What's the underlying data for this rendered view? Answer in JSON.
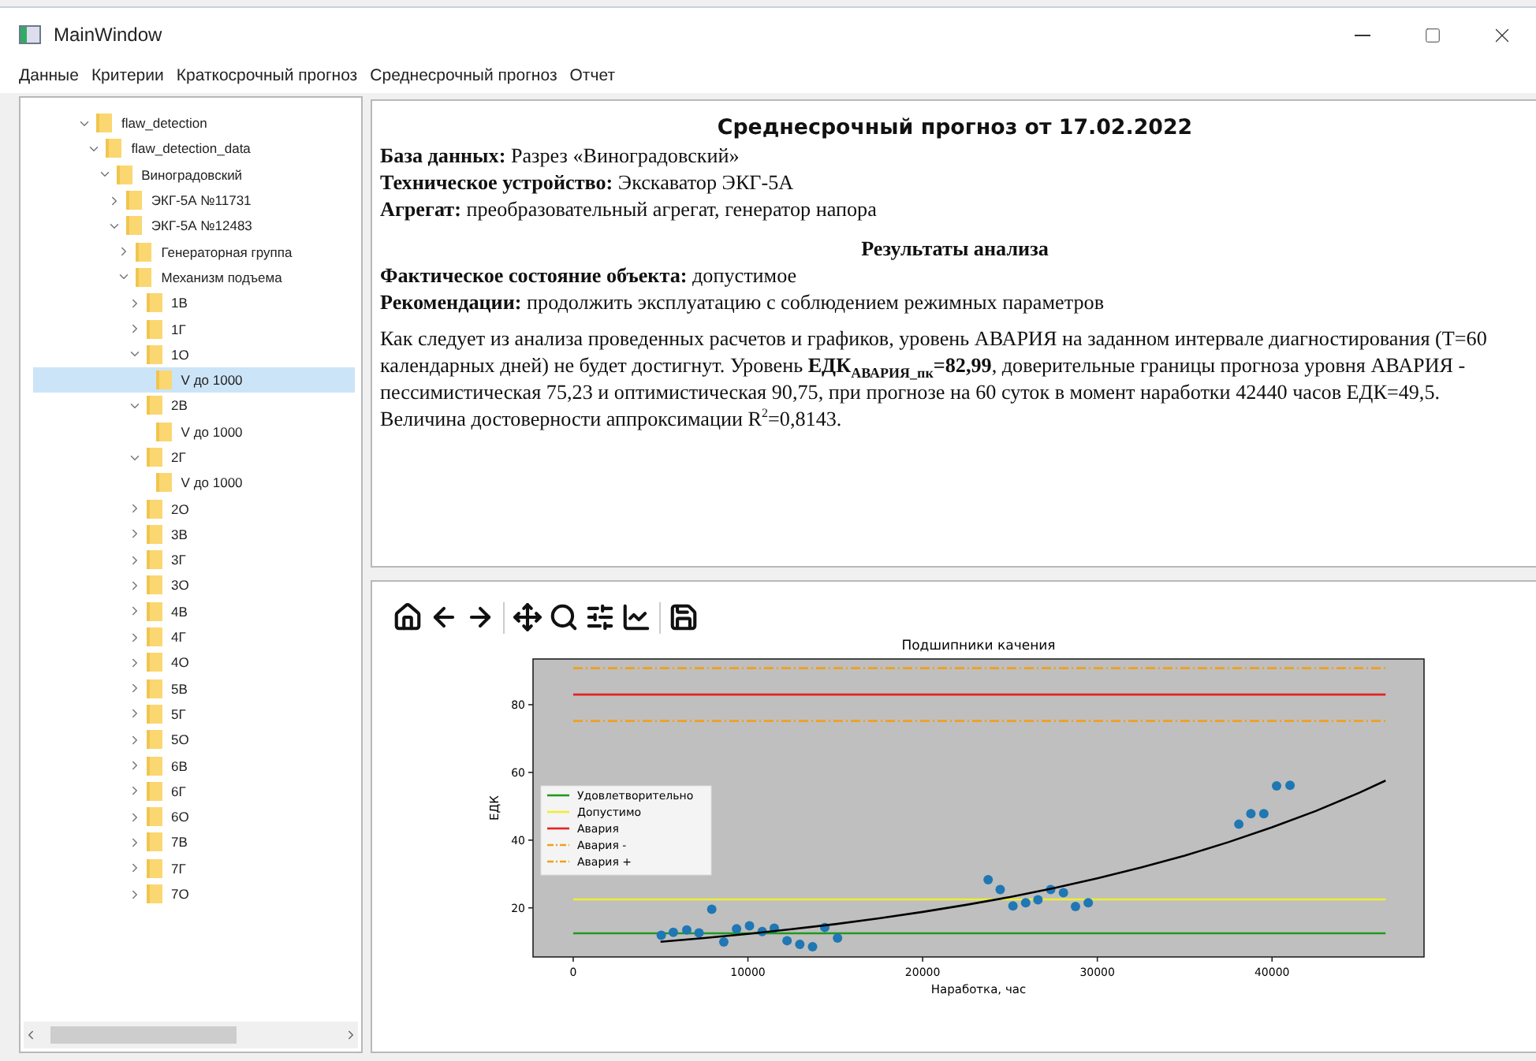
{
  "window": {
    "title": "MainWindow"
  },
  "menu": [
    "Данные",
    "Критерии",
    "Краткосрочный прогноз",
    "Среднесрочный прогноз",
    "Отчет"
  ],
  "tree": [
    {
      "label": "flaw_detection",
      "expanded": true,
      "selected": false,
      "children": [
        {
          "label": "flaw_detection_data",
          "expanded": true,
          "selected": false,
          "children": [
            {
              "label": "Виноградовский",
              "expanded": true,
              "selected": false,
              "children": [
                {
                  "label": "ЭКГ-5А №11731",
                  "expanded": false,
                  "selected": false
                },
                {
                  "label": "ЭКГ-5А №12483",
                  "expanded": true,
                  "selected": false,
                  "children": [
                    {
                      "label": "Генераторная группа",
                      "expanded": false,
                      "selected": false
                    },
                    {
                      "label": "Механизм подъема",
                      "expanded": true,
                      "selected": false,
                      "children": [
                        {
                          "label": "1В",
                          "expanded": false,
                          "selected": false
                        },
                        {
                          "label": "1Г",
                          "expanded": false,
                          "selected": false
                        },
                        {
                          "label": "1О",
                          "expanded": true,
                          "selected": false,
                          "children": [
                            {
                              "label": "V до 1000",
                              "selected": true
                            }
                          ]
                        },
                        {
                          "label": "2В",
                          "expanded": true,
                          "selected": false,
                          "children": [
                            {
                              "label": "V до 1000",
                              "selected": false
                            }
                          ]
                        },
                        {
                          "label": "2Г",
                          "expanded": true,
                          "selected": false,
                          "children": [
                            {
                              "label": "V до 1000",
                              "selected": false
                            }
                          ]
                        },
                        {
                          "label": "2О",
                          "expanded": false,
                          "selected": false
                        },
                        {
                          "label": "3В",
                          "expanded": false,
                          "selected": false
                        },
                        {
                          "label": "3Г",
                          "expanded": false,
                          "selected": false
                        },
                        {
                          "label": "3О",
                          "expanded": false,
                          "selected": false
                        },
                        {
                          "label": "4В",
                          "expanded": false,
                          "selected": false
                        },
                        {
                          "label": "4Г",
                          "expanded": false,
                          "selected": false
                        },
                        {
                          "label": "4О",
                          "expanded": false,
                          "selected": false
                        },
                        {
                          "label": "5В",
                          "expanded": false,
                          "selected": false
                        },
                        {
                          "label": "5Г",
                          "expanded": false,
                          "selected": false
                        },
                        {
                          "label": "5О",
                          "expanded": false,
                          "selected": false
                        },
                        {
                          "label": "6В",
                          "expanded": false,
                          "selected": false
                        },
                        {
                          "label": "6Г",
                          "expanded": false,
                          "selected": false
                        },
                        {
                          "label": "6О",
                          "expanded": false,
                          "selected": false
                        },
                        {
                          "label": "7В",
                          "expanded": false,
                          "selected": false
                        },
                        {
                          "label": "7Г",
                          "expanded": false,
                          "selected": false
                        },
                        {
                          "label": "7О",
                          "expanded": false,
                          "selected": false
                        }
                      ]
                    }
                  ]
                }
              ]
            }
          ]
        }
      ]
    }
  ],
  "report": {
    "title": "Среднесрочный прогноз от 17.02.2022",
    "details": [
      "**База данных:** Разрез «Виноградовский»",
      "**Техническое устройство:** Экскаватор ЭКГ-5А",
      "**Агрегат:** преобразовательный агрегат, генератор напора"
    ],
    "section_title": "Результаты анализа",
    "findings": [
      "**Фактическое состояние объекта:** допустимое",
      "**Рекомендации:** продолжить эксплуатацию с соблюдением режимных параметров"
    ],
    "paragraph": "Как следует из анализа проведенных расчетов и графиков, уровень АВАРИЯ на заданном интервале диагностирования (Т=60 календарных дней) не будет достигнут. Уровень **ЕДК**$_{АВАРИЯ_пк}$**=82,99**, доверительные границы прогноза уровня АВАРИЯ - пессимистическая 75,23 и оптимистическая 90,75, при прогнозе на 60 суток в момент наработки 42440 часов ЕДК=49,5. Величина достоверности аппроксимации R$^{2}$=0,8143."
  },
  "plot": {
    "chart_data": {
      "type": "scatter",
      "title": "Подшипники качения",
      "xlabel": "Наработка, час",
      "ylabel": "ЕДК",
      "xlim": [
        -2300,
        48700
      ],
      "ylim": [
        5.5,
        93.5
      ],
      "xticks": [
        0,
        10000,
        20000,
        30000,
        40000
      ],
      "yticks": [
        20,
        40,
        60,
        80
      ],
      "legend": "center left",
      "series": [
        {
          "name": "Удовлетворительно",
          "color": "#1f9a1f",
          "type": "line",
          "x": [
            0,
            46500
          ],
          "values": [
            12.5,
            12.5
          ]
        },
        {
          "name": "Допустимо",
          "color": "#eeee33",
          "type": "line",
          "x": [
            0,
            46500
          ],
          "values": [
            22.5,
            22.5
          ]
        },
        {
          "name": "Авария",
          "color": "#e52222",
          "type": "line",
          "x": [
            0,
            46500
          ],
          "values": [
            83,
            83
          ]
        },
        {
          "name": "Авария -",
          "color": "#f0a020",
          "type": "line",
          "line_style": "dashdot",
          "x": [
            0,
            46500
          ],
          "values": [
            75.2,
            75.2
          ]
        },
        {
          "name": "Авария +",
          "color": "#f0a020",
          "type": "line",
          "line_style": "dashdot",
          "x": [
            0,
            46500
          ],
          "values": [
            90.8,
            90.8
          ]
        },
        {
          "color": "#1f77b4",
          "type": "scatter",
          "x": [
            5040,
            5730,
            6500,
            7200,
            7930,
            8620,
            9350,
            10090,
            10820,
            11510,
            12240,
            12970,
            13700,
            14400,
            15130,
            23750,
            24440,
            25170,
            25900,
            26600,
            27330,
            28060,
            28750,
            29480,
            38100,
            38790,
            39530,
            40260,
            41030
          ],
          "values": [
            11.9,
            12.8,
            13.5,
            12.6,
            19.6,
            9.9,
            13.8,
            14.7,
            13.0,
            14.0,
            10.3,
            9.2,
            8.5,
            14.2,
            11.1,
            28.3,
            25.4,
            20.6,
            21.5,
            22.4,
            25.4,
            24.5,
            20.4,
            21.5,
            44.7,
            47.8,
            47.8,
            56.0,
            56.2
          ]
        },
        {
          "color": "#000000",
          "type": "line",
          "x": [
            5000,
            7500,
            10000,
            12500,
            15000,
            17500,
            20000,
            22500,
            25000,
            27500,
            30000,
            32500,
            35000,
            37500,
            40000,
            42500,
            45000,
            46500
          ],
          "values": [
            10.0,
            11.1,
            12.3,
            13.7,
            15.2,
            16.9,
            18.8,
            20.9,
            23.2,
            25.8,
            28.7,
            31.9,
            35.4,
            39.4,
            43.8,
            48.6,
            54.0,
            57.6
          ]
        }
      ]
    }
  }
}
